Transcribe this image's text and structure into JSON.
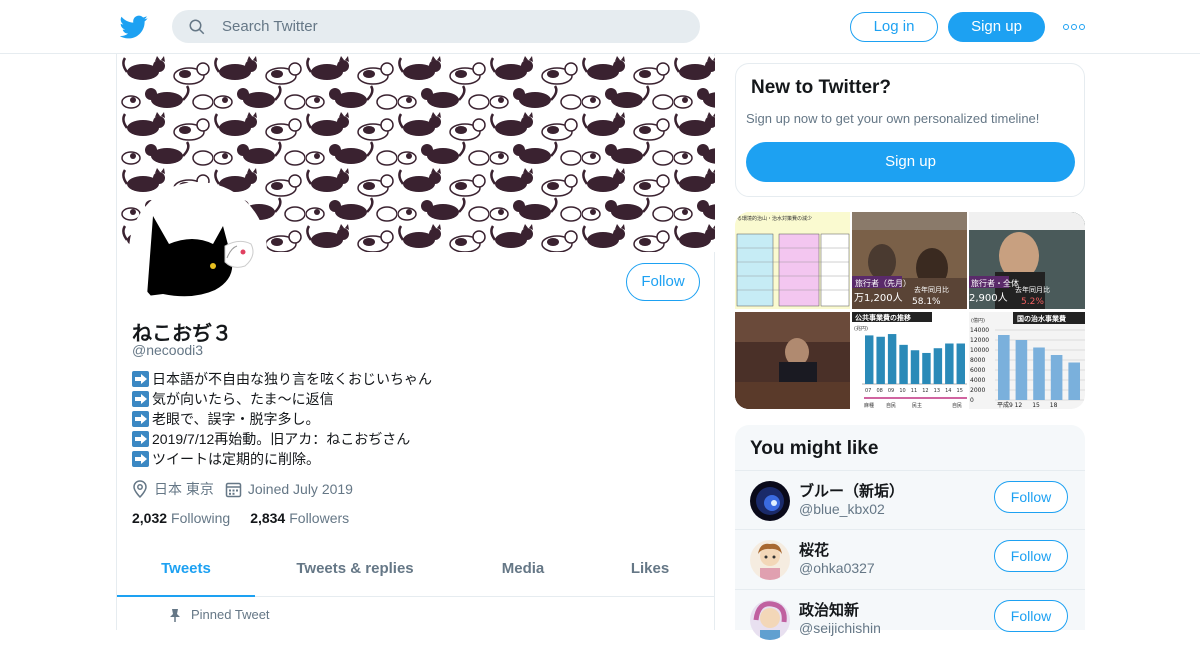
{
  "header": {
    "search_placeholder": "Search Twitter",
    "login_label": "Log in",
    "signup_label": "Sign up",
    "accent": "#1da1f2"
  },
  "profile": {
    "name": "ねこおぢ３",
    "handle": "@necoodi3",
    "follow_label": "Follow",
    "bio": [
      "日本語が不自由な独り言を呟くおじいちゃん",
      "気が向いたら、たま～に返信",
      "老眼で、誤字・脱字多し。",
      "2019/7/12再始動。旧アカ：ねこおぢさん",
      "ツイートは定期的に削除。"
    ],
    "location": "日本 東京",
    "joined": "Joined July 2019",
    "following_count": "2,032",
    "following_label": "Following",
    "followers_count": "2,834",
    "followers_label": "Followers"
  },
  "tabs": [
    {
      "label": "Tweets",
      "active": true
    },
    {
      "label": "Tweets & replies",
      "active": false
    },
    {
      "label": "Media",
      "active": false
    },
    {
      "label": "Likes",
      "active": false
    }
  ],
  "pinned_label": "Pinned Tweet",
  "new_to_twitter": {
    "title": "New to Twitter?",
    "description": "Sign up now to get your own personalized timeline!",
    "button": "Sign up"
  },
  "media_thumbs": {
    "t1_title": "る環境的治山・治水対策費の減少",
    "t2_name": "旅行者（先月）",
    "t2_value": "万1,200人",
    "t2_pct_label": "去年同月比",
    "t2_pct": "58.1%",
    "t3_name": "旅行者・全体",
    "t3_value": "2,900人",
    "t3_pct_label": "去年同月比",
    "t3_pct": "5.2%",
    "t5_title": "公共事業費の推移",
    "t5_unit": "(兆円)",
    "t5_xticks": [
      "07",
      "08",
      "09",
      "10",
      "11",
      "12",
      "13",
      "14",
      "15"
    ],
    "t5_bottom": [
      "麻種",
      "自民",
      "民主",
      "自民"
    ],
    "t6_title": "国の治水事業費",
    "t6_unit": "(億円)",
    "t6_yticks": [
      "14000",
      "12000",
      "10000",
      "8000",
      "6000",
      "4000",
      "2000",
      "0"
    ],
    "t6_xticks": [
      "平成9",
      "12",
      "15",
      "18"
    ]
  },
  "chart_data": [
    {
      "type": "bar",
      "title": "公共事業費の推移",
      "ylabel": "(兆円)",
      "categories": [
        "07",
        "08",
        "09",
        "10",
        "11",
        "12",
        "13",
        "14",
        "15"
      ],
      "values": [
        7.2,
        7.0,
        7.4,
        5.8,
        5.0,
        4.6,
        5.3,
        6.0,
        6.0
      ],
      "ylim": [
        0,
        8
      ]
    },
    {
      "type": "bar",
      "title": "国の治水事業費",
      "ylabel": "(億円)",
      "categories": [
        "平成9",
        "12",
        "15",
        "18"
      ],
      "values": [
        13000,
        12000,
        10500,
        9000,
        7500
      ],
      "ylim": [
        0,
        14000
      ]
    }
  ],
  "you_might_like": {
    "title": "You might like",
    "users": [
      {
        "name": "ブルー（新垢）",
        "handle": "@blue_kbx02",
        "follow": "Follow"
      },
      {
        "name": "桜花",
        "handle": "@ohka0327",
        "follow": "Follow"
      },
      {
        "name": "政治知新",
        "handle": "@seijichishin",
        "follow": "Follow"
      }
    ]
  }
}
